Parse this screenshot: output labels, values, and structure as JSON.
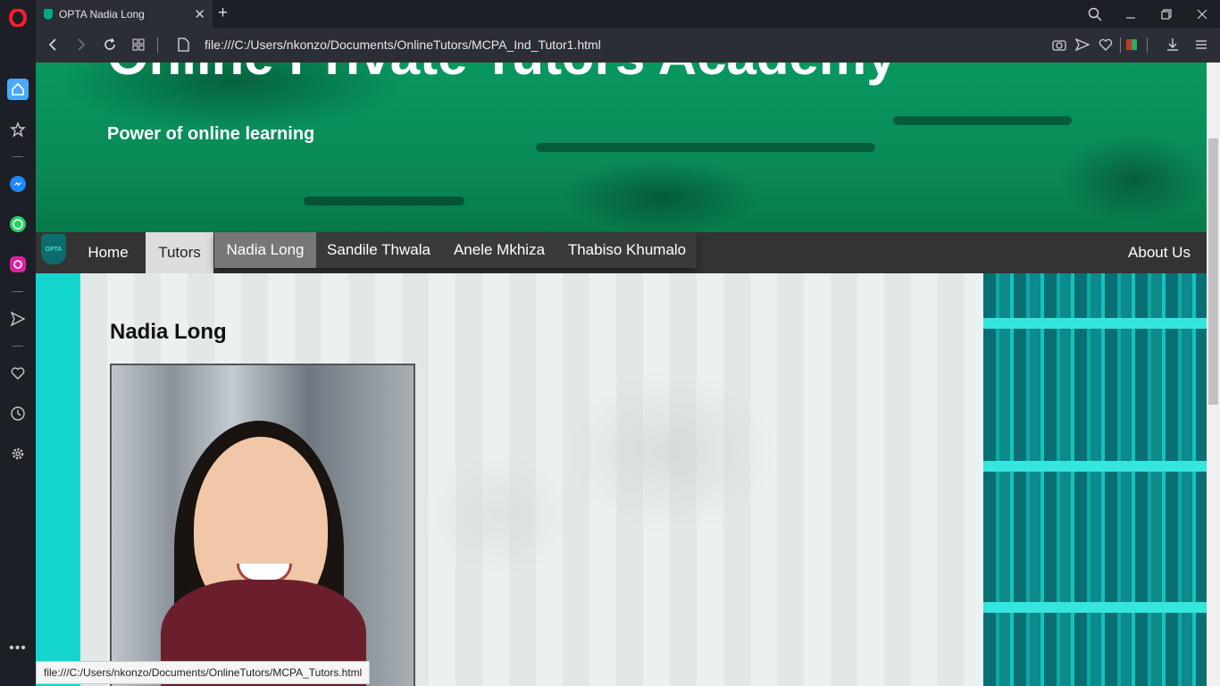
{
  "browser": {
    "tab_title": "OPTA Nadia Long",
    "new_tab": "+",
    "url": "file:///C:/Users/nkonzo/Documents/OnlineTutors/MCPA_Ind_Tutor1.html",
    "status_url": "file:///C:/Users/nkonzo/Documents/OnlineTutors/MCPA_Tutors.html"
  },
  "sidebar": {
    "icons": [
      "opera-logo-icon",
      "home-icon",
      "star-icon",
      "messenger-icon",
      "whatsapp-icon",
      "instagram-icon",
      "send-icon",
      "heart-icon",
      "history-icon",
      "settings-icon",
      "more-icon"
    ]
  },
  "site": {
    "title": "Online Private Tutors Academy",
    "tagline": "Power of online learning",
    "logo_text": "OPTA"
  },
  "nav": {
    "home": "Home",
    "tutors": "Tutors",
    "about": "About Us",
    "dropdown": [
      "Nadia Long",
      "Sandile Thwala",
      "Anele Mkhiza",
      "Thabiso Khumalo"
    ]
  },
  "tutor": {
    "name": "Nadia Long"
  },
  "colors": {
    "hero_green": "#07985f",
    "navbar": "#333333",
    "accent_cyan": "#14d6cf"
  }
}
